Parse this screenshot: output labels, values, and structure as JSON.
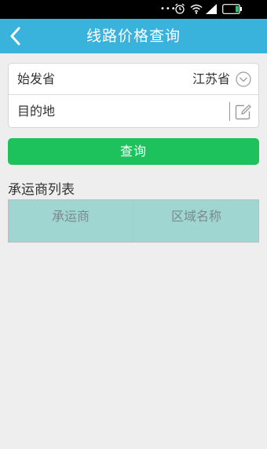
{
  "status_bar": {
    "icons": [
      "dots-icon",
      "alarm-icon",
      "wifi-icon",
      "signal-icon",
      "battery-icon"
    ],
    "dots": "•••"
  },
  "header": {
    "title": "线路价格查询",
    "back_icon": "back-arrow-icon",
    "background": "#39b2dc"
  },
  "form": {
    "origin": {
      "label": "始发省",
      "value": "江苏省",
      "icon": "chevron-down-icon"
    },
    "destination": {
      "label": "目的地",
      "value": "",
      "icon": "edit-icon"
    }
  },
  "query_button": {
    "label": "查询",
    "color": "#1dc25c"
  },
  "carrier_list": {
    "title": "承运商列表",
    "columns": [
      "承运商",
      "区域名称"
    ],
    "header_color": "#9fd6d2",
    "rows": []
  }
}
